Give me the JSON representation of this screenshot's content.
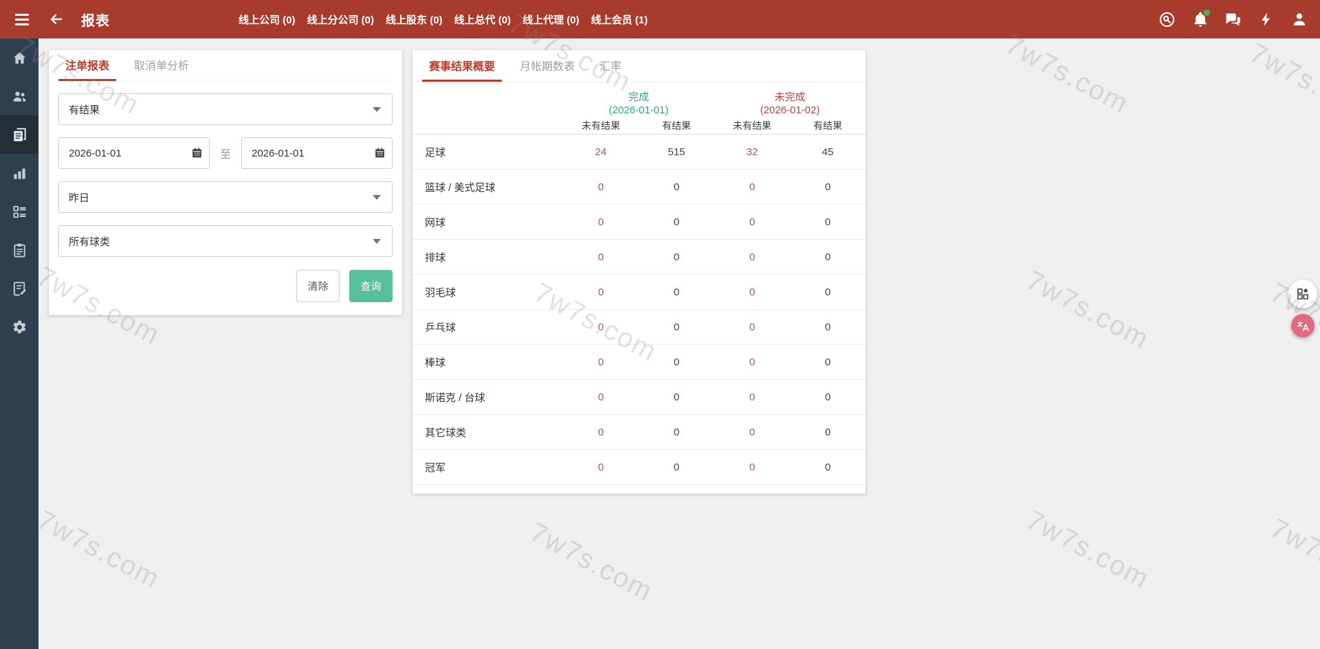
{
  "topbar": {
    "title": "报表",
    "nav_items": [
      "线上公司 (0)",
      "线上分公司 (0)",
      "线上股东 (0)",
      "线上总代 (0)",
      "线上代理 (0)",
      "线上会员 (1)"
    ]
  },
  "filter_panel": {
    "tabs": {
      "bet_report": "注单报表",
      "cancel_analysis": "取消单分析"
    },
    "result_select": "有结果",
    "date_from": "2026-01-01",
    "date_separator": "至",
    "date_to": "2026-01-01",
    "range_select": "昨日",
    "sport_select": "所有球类",
    "clear_label": "清除",
    "query_label": "查询"
  },
  "report_panel": {
    "tabs": {
      "summary": "赛事结果概要",
      "monthly": "月帐期数表",
      "rate": "汇率"
    },
    "table": {
      "groups": [
        {
          "title": "完成",
          "date": "(2026-01-01)"
        },
        {
          "title": "未完成",
          "date": "(2026-01-02)"
        }
      ],
      "sub_headers": [
        "未有结果",
        "有结果",
        "未有结果",
        "有结果"
      ],
      "rows": [
        {
          "label": "足球",
          "values": [
            "24",
            "515",
            "32",
            "45"
          ]
        },
        {
          "label": "篮球 / 美式足球",
          "values": [
            "0",
            "0",
            "0",
            "0"
          ]
        },
        {
          "label": "网球",
          "values": [
            "0",
            "0",
            "0",
            "0"
          ]
        },
        {
          "label": "排球",
          "values": [
            "0",
            "0",
            "0",
            "0"
          ]
        },
        {
          "label": "羽毛球",
          "values": [
            "0",
            "0",
            "0",
            "0"
          ]
        },
        {
          "label": "乒乓球",
          "values": [
            "0",
            "0",
            "0",
            "0"
          ]
        },
        {
          "label": "棒球",
          "values": [
            "0",
            "0",
            "0",
            "0"
          ]
        },
        {
          "label": "斯诺克 / 台球",
          "values": [
            "0",
            "0",
            "0",
            "0"
          ]
        },
        {
          "label": "其它球类",
          "values": [
            "0",
            "0",
            "0",
            "0"
          ]
        },
        {
          "label": "冠军",
          "values": [
            "0",
            "0",
            "0",
            "0"
          ]
        }
      ]
    }
  },
  "watermark": {
    "text": "7w7s.com"
  },
  "colors": {
    "topbar_bg": "#a93b2c",
    "sidebar_bg": "#2e4050",
    "accent_red": "#c0392b",
    "green_button": "#57bf9a",
    "teal_header": "#2aa791",
    "red_header": "#b5443a",
    "value_red": "#b2554a",
    "notification_dot": "#4caf50",
    "fab_pink": "#e06a84"
  }
}
